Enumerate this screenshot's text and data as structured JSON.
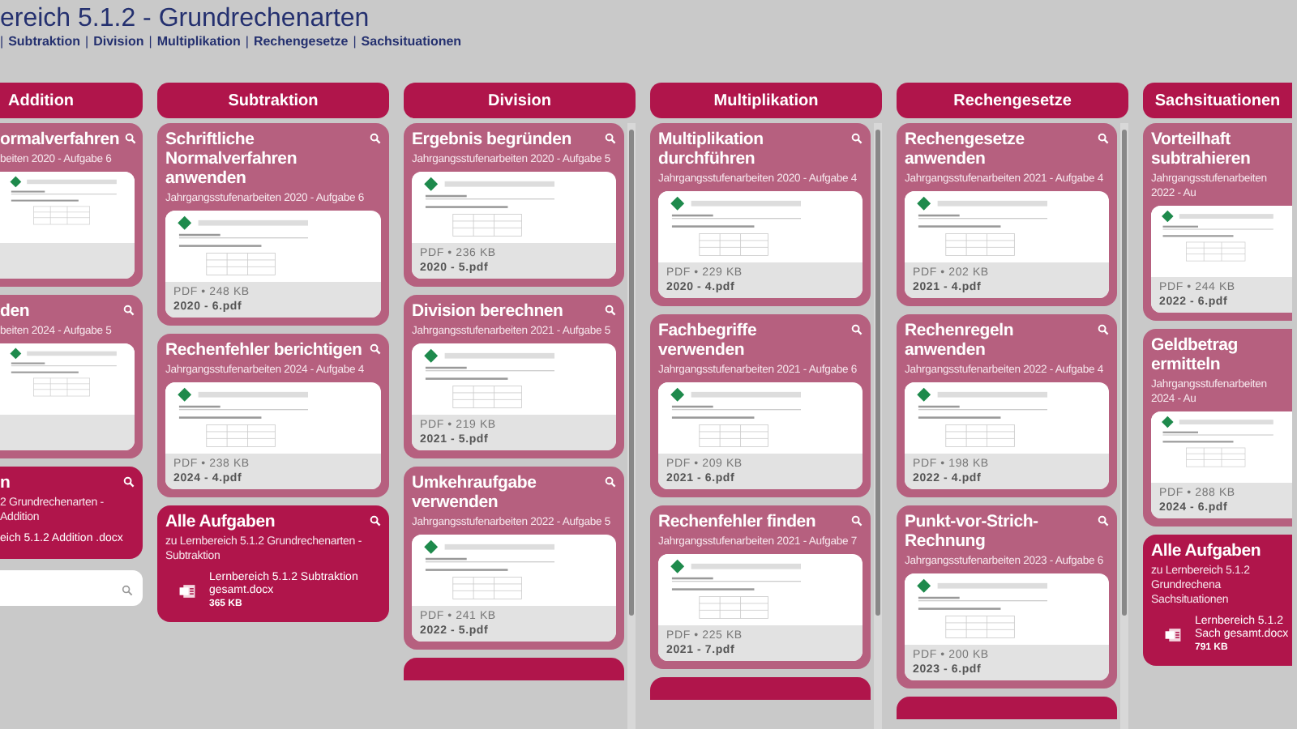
{
  "header": {
    "title": "ereich 5.1.2 - Grundrechenarten",
    "breadcrumb": [
      {
        "kind": "sep",
        "text": "|"
      },
      {
        "kind": "link",
        "text": "Subtraktion"
      },
      {
        "kind": "sep",
        "text": "|"
      },
      {
        "kind": "link",
        "text": "Division"
      },
      {
        "kind": "sep",
        "text": "|"
      },
      {
        "kind": "link",
        "text": "Multiplikation"
      },
      {
        "kind": "sep",
        "text": "|"
      },
      {
        "kind": "link",
        "text": "Rechengesetze"
      },
      {
        "kind": "sep",
        "text": "|"
      },
      {
        "kind": "link",
        "text": "Sachsituationen"
      }
    ]
  },
  "columns": [
    {
      "header": "Addition",
      "scrollbar": false,
      "more_below": false,
      "cards": [
        {
          "kind": "doc",
          "title": "ormalverfahren",
          "subtitle": "beiten 2020 - Aufgabe 6"
        },
        {
          "kind": "doc",
          "title": "den",
          "subtitle": "beiten 2024 - Aufgabe 5"
        },
        {
          "kind": "all",
          "title": "n",
          "subtitle": "2 Grundrechenarten - Addition",
          "file_name": "eich 5.1.2 Addition .docx"
        },
        {
          "kind": "search"
        }
      ]
    },
    {
      "header": "Subtraktion",
      "scrollbar": false,
      "more_below": false,
      "cards": [
        {
          "kind": "doc",
          "title": "Schriftliche Normalverfahren anwenden",
          "subtitle": "Jahrgangsstufenarbeiten 2020 - Aufgabe 6",
          "meta": "PDF • 248 KB",
          "file_name": "2020 - 6.pdf"
        },
        {
          "kind": "doc",
          "title": "Rechenfehler berichtigen",
          "subtitle": "Jahrgangsstufenarbeiten 2024 - Aufgabe 4",
          "meta": "PDF • 238 KB",
          "file_name": "2024 - 4.pdf"
        },
        {
          "kind": "all",
          "title": "Alle Aufgaben",
          "subtitle": "zu Lernbereich 5.1.2 Grundrechenarten - Subtraktion",
          "file_name": "Lernbereich 5.1.2 Subtraktion gesamt.docx",
          "size": "365 KB"
        }
      ]
    },
    {
      "header": "Division",
      "scrollbar": true,
      "more_below": true,
      "cards": [
        {
          "kind": "doc",
          "title": "Ergebnis begründen",
          "subtitle": "Jahrgangsstufenarbeiten 2020 - Aufgabe 5",
          "meta": "PDF • 236 KB",
          "file_name": "2020 - 5.pdf"
        },
        {
          "kind": "doc",
          "title": "Division berechnen",
          "subtitle": "Jahrgangsstufenarbeiten 2021 - Aufgabe 5",
          "meta": "PDF • 219 KB",
          "file_name": "2021 - 5.pdf"
        },
        {
          "kind": "doc",
          "title": "Umkehraufgabe verwenden",
          "subtitle": "Jahrgangsstufenarbeiten 2022 - Aufgabe 5",
          "meta": "PDF • 241 KB",
          "file_name": "2022 - 5.pdf"
        }
      ]
    },
    {
      "header": "Multiplikation",
      "scrollbar": true,
      "more_below": true,
      "cards": [
        {
          "kind": "doc",
          "title": "Multiplikation durchführen",
          "subtitle": "Jahrgangsstufenarbeiten 2020 - Aufgabe 4",
          "meta": "PDF • 229 KB",
          "file_name": "2020 - 4.pdf"
        },
        {
          "kind": "doc",
          "title": "Fachbegriffe verwenden",
          "subtitle": "Jahrgangsstufenarbeiten 2021 - Aufgabe 6",
          "meta": "PDF • 209 KB",
          "file_name": "2021 - 6.pdf"
        },
        {
          "kind": "doc",
          "title": "Rechenfehler finden",
          "subtitle": "Jahrgangsstufenarbeiten 2021 - Aufgabe 7",
          "meta": "PDF • 225 KB",
          "file_name": "2021 - 7.pdf"
        }
      ]
    },
    {
      "header": "Rechengesetze",
      "scrollbar": true,
      "more_below": true,
      "cards": [
        {
          "kind": "doc",
          "title": "Rechengesetze anwenden",
          "subtitle": "Jahrgangsstufenarbeiten 2021 - Aufgabe 4",
          "meta": "PDF • 202 KB",
          "file_name": "2021 - 4.pdf"
        },
        {
          "kind": "doc",
          "title": "Rechenregeln anwenden",
          "subtitle": "Jahrgangsstufenarbeiten 2022 - Aufgabe 4",
          "meta": "PDF • 198 KB",
          "file_name": "2022 - 4.pdf"
        },
        {
          "kind": "doc",
          "title": "Punkt-vor-Strich-Rechnung",
          "subtitle": "Jahrgangsstufenarbeiten 2023 - Aufgabe 6",
          "meta": "PDF • 200 KB",
          "file_name": "2023 - 6.pdf"
        }
      ]
    },
    {
      "header": "Sachsituationen",
      "scrollbar": false,
      "more_below": false,
      "cards": [
        {
          "kind": "doc",
          "title": "Vorteilhaft subtrahieren",
          "subtitle": "Jahrgangsstufenarbeiten 2022 - Au",
          "meta": "PDF • 244 KB",
          "file_name": "2022 - 6.pdf"
        },
        {
          "kind": "doc",
          "title": "Geldbetrag ermitteln",
          "subtitle": "Jahrgangsstufenarbeiten 2024 - Au",
          "meta": "PDF • 288 KB",
          "file_name": "2024 - 6.pdf"
        },
        {
          "kind": "all",
          "title": "Alle Aufgaben",
          "subtitle": "zu Lernbereich 5.1.2 Grundrechena Sachsituationen",
          "file_name": "Lernbereich 5.1.2 Sach gesamt.docx",
          "size": "791 KB"
        }
      ]
    }
  ]
}
